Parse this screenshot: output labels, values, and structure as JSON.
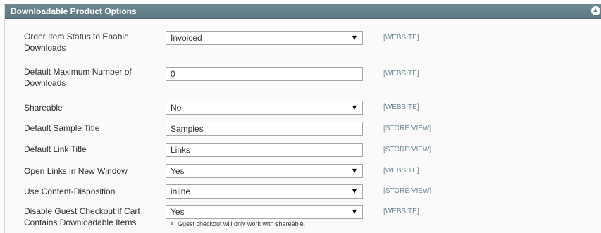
{
  "section": {
    "title": "Downloadable Product Options",
    "collapse_icon": "chevron-up-circle-icon"
  },
  "fields": [
    {
      "label": "Order Item Status to Enable Downloads",
      "type": "select",
      "value": "Invoiced",
      "scope": "[WEBSITE]"
    },
    {
      "label": "Default Maximum Number of Downloads",
      "type": "text",
      "value": "0",
      "scope": "[WEBSITE]"
    },
    {
      "label": "Shareable",
      "type": "select",
      "value": "No",
      "scope": "[WEBSITE]"
    },
    {
      "label": "Default Sample Title",
      "type": "text",
      "value": "Samples",
      "scope": "[STORE VIEW]"
    },
    {
      "label": "Default Link Title",
      "type": "text",
      "value": "Links",
      "scope": "[STORE VIEW]"
    },
    {
      "label": "Open Links in New Window",
      "type": "select",
      "value": "Yes",
      "scope": "[WEBSITE]"
    },
    {
      "label": "Use Content-Disposition",
      "type": "select",
      "value": "inline",
      "scope": "[STORE VIEW]"
    },
    {
      "label": "Disable Guest Checkout if Cart Contains Downloadable Items",
      "type": "select",
      "value": "Yes",
      "scope": "[WEBSITE]",
      "note": "Guest checkout will only work with shareable."
    }
  ],
  "colors": {
    "header_bg": "#5d7880",
    "scope_text": "#6f8992",
    "body_bg": "#fafafa"
  }
}
